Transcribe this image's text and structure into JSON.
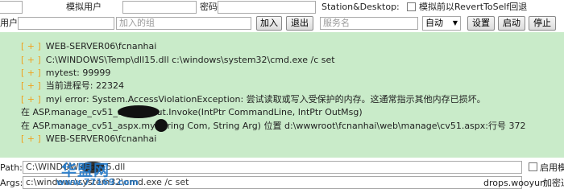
{
  "toolbar": {
    "row1": {
      "mock_user_label": "模拟用户",
      "password_label": "密码",
      "station_label": "Station&Desktop:",
      "revert_label": "模拟前以RevertToSelf回退"
    },
    "row2": {
      "user_label": "用户",
      "join_group_placeholder": "加入的组",
      "join_button": "加入",
      "exit_button": "退出",
      "service_name_placeholder": "服务名",
      "start_type_value": "自动",
      "set_button": "设置",
      "start_button": "启动",
      "stop_button": "停止"
    }
  },
  "output": {
    "lines": [
      {
        "tag": "[ + ]",
        "text": "WEB-SERVER06\\fcnanhai"
      },
      {
        "tag": "[ + ]",
        "text": "C:\\WINDOWS\\Temp\\dll15.dll c:\\windows\\system32\\cmd.exe /c set"
      },
      {
        "tag": "[ + ]",
        "text": "mytest: 99999"
      },
      {
        "tag": "[ + ]",
        "text": "当前进程号: 22324"
      },
      {
        "tag": "[ + ]",
        "text": "myi error: System.AccessViolationException: 尝试读取或写入受保护的内存。这通常指示其他内存已损坏。"
      },
      {
        "tag": "",
        "text": "在 ASP.manage_cv51_aspx.           1Out.Invoke(IntPtr CommandLine, IntPtr OutMsg)"
      },
      {
        "tag": "",
        "text": "在 ASP.manage_cv51_aspx.my    String Com, String Arg) 位置 d:\\wwwroot\\fcnanhai\\web\\manage\\cv51.aspx:行号 372"
      },
      {
        "tag": "[ + ]",
        "text": "WEB-SERVER06\\fcnanhai"
      }
    ]
  },
  "bottom": {
    "path_label": "Path:",
    "path_value": "C:\\WINDOWS\\                  dll15.dll",
    "enable_label": "启用模",
    "args_label": "Args:",
    "args_value": "c:\\windows\\system32\\cmd.exe /c set",
    "site_text": "drops.wooyun",
    "trailing_text": "加密通"
  },
  "watermark": {
    "text": "华盟网",
    "url": "www.77169.com"
  },
  "colors": {
    "output_bg": "#c9ebc9",
    "tag_color": "#f0a11c",
    "watermark": "#1f77c8"
  }
}
